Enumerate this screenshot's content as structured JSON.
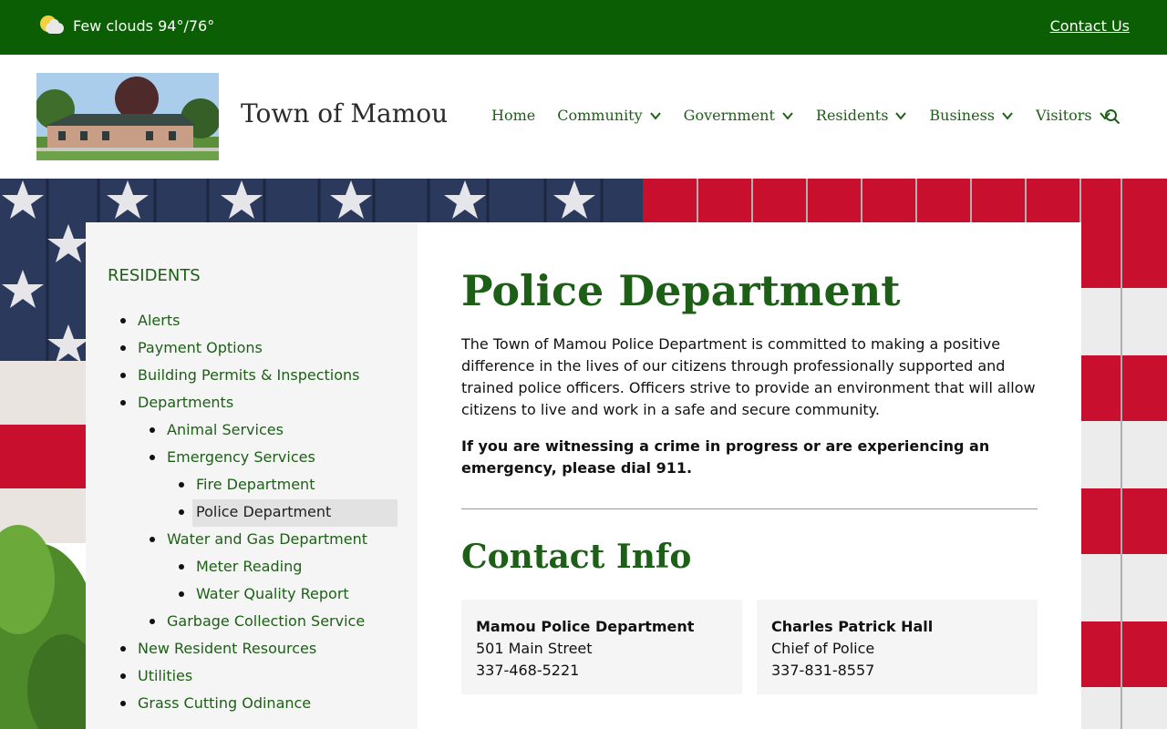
{
  "topbar": {
    "weather_text": "Few clouds 94°/76°",
    "weather_icon": "partly-cloudy-icon",
    "contact_label": "Contact Us",
    "bg_color": "#0b5e04"
  },
  "header": {
    "site_title": "Town of Mamou",
    "nav": [
      {
        "label": "Home",
        "has_dropdown": false
      },
      {
        "label": "Community",
        "has_dropdown": true
      },
      {
        "label": "Government",
        "has_dropdown": true
      },
      {
        "label": "Residents",
        "has_dropdown": true
      },
      {
        "label": "Business",
        "has_dropdown": true
      },
      {
        "label": "Visitors",
        "has_dropdown": true
      }
    ],
    "search_icon": "search-icon"
  },
  "sidebar": {
    "title": "RESIDENTS",
    "items": [
      {
        "label": "Alerts",
        "level": 0
      },
      {
        "label": "Payment Options",
        "level": 0
      },
      {
        "label": "Building Permits & Inspections",
        "level": 0
      },
      {
        "label": "Departments",
        "level": 0
      },
      {
        "label": "Animal Services",
        "level": 1
      },
      {
        "label": "Emergency Services",
        "level": 1
      },
      {
        "label": "Fire Department",
        "level": 2
      },
      {
        "label": "Police Department",
        "level": 2,
        "active": true
      },
      {
        "label": "Water and Gas Department",
        "level": 1
      },
      {
        "label": "Meter Reading",
        "level": 2
      },
      {
        "label": "Water Quality Report",
        "level": 2
      },
      {
        "label": "Garbage Collection Service",
        "level": 1
      },
      {
        "label": "New Resident Resources",
        "level": 0
      },
      {
        "label": "Utilities",
        "level": 0
      },
      {
        "label": "Grass Cutting Odinance",
        "level": 0
      }
    ]
  },
  "main": {
    "title": "Police Department",
    "intro": "The Town of Mamou Police Department is committed to making a positive difference in the lives of our citizens through professionally supported and trained police officers. Officers strive to provide an environment that will allow citizens to live and work in a safe and secure community.",
    "emergency": "If you are witnessing a crime in progress or are experiencing an emergency, please dial 911.",
    "contact_title": "Contact Info",
    "contacts": [
      {
        "name": "Mamou Police Department",
        "line1": "501 Main Street",
        "line2": "337-468-5221"
      },
      {
        "name": "Charles Patrick Hall",
        "line1": "Chief of Police",
        "line2": "337-831-8557"
      }
    ]
  },
  "colors": {
    "brand_green": "#0b5e04",
    "link_green": "#1d5f16",
    "flag_red": "#c8102e",
    "flag_blue": "#2b3a5c"
  }
}
